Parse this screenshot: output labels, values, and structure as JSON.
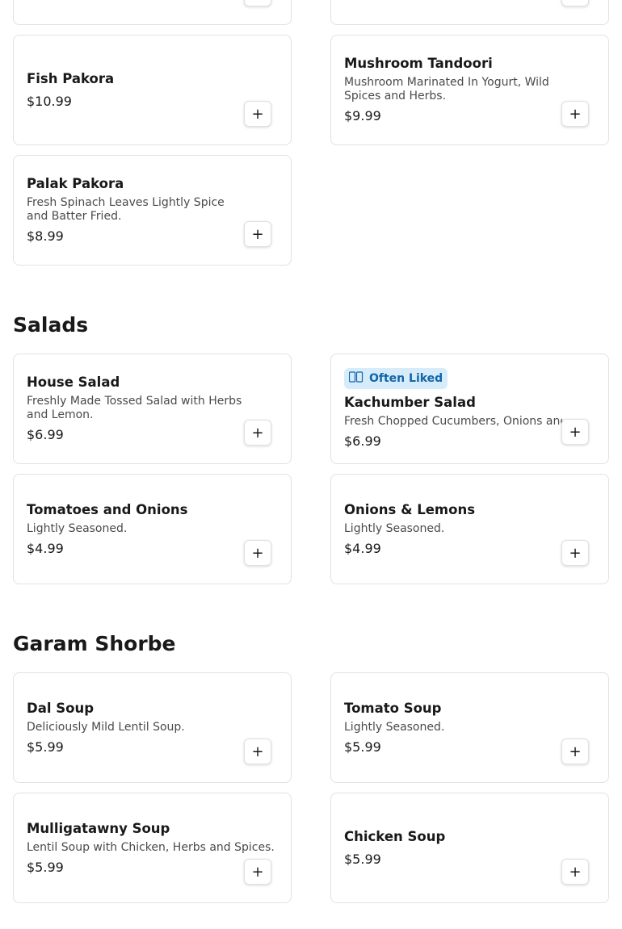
{
  "add_symbol": "+",
  "sections": {
    "salads": {
      "title": "Salads"
    },
    "garam_shorbe": {
      "title": "Garam Shorbe"
    }
  },
  "items": {
    "fish_pakora": {
      "name": "Fish Pakora",
      "description": "",
      "price": "$10.99"
    },
    "mushroom_tandoori": {
      "name": "Mushroom Tandoori",
      "description": "Mushroom Marinated In Yogurt, Wild Spices and Herbs.",
      "price": "$9.99"
    },
    "palak_pakora": {
      "name": "Palak Pakora",
      "description": "Fresh Spinach Leaves Lightly Spice and Batter Fried.",
      "price": "$8.99"
    },
    "house_salad": {
      "name": "House Salad",
      "description": "Freshly Made Tossed Salad with Herbs and Lemon.",
      "price": "$6.99"
    },
    "kachumber_salad": {
      "badge": "Often Liked",
      "badge_icon": "thumbs-up-icon",
      "name": "Kachumber Salad",
      "description": "Fresh Chopped Cucumbers, Onions and",
      "price": "$6.99"
    },
    "tomatoes_onions": {
      "name": "Tomatoes and Onions",
      "description": "Lightly Seasoned.",
      "price": "$4.99"
    },
    "onions_lemons": {
      "name": "Onions & Lemons",
      "description": "Lightly Seasoned.",
      "price": "$4.99"
    },
    "dal_soup": {
      "name": "Dal Soup",
      "description": "Deliciously Mild Lentil Soup.",
      "price": "$5.99"
    },
    "tomato_soup": {
      "name": "Tomato Soup",
      "description": "Lightly Seasoned.",
      "price": "$5.99"
    },
    "mulligatawny_soup": {
      "name": "Mulligatawny Soup",
      "description": "Lentil Soup with Chicken, Herbs and Spices.",
      "price": "$5.99"
    },
    "chicken_soup": {
      "name": "Chicken Soup",
      "description": "",
      "price": "$5.99"
    }
  },
  "colors": {
    "badge_bg": "#d6ecfb",
    "badge_text": "#1266a8",
    "card_border": "#e2e2e2"
  }
}
